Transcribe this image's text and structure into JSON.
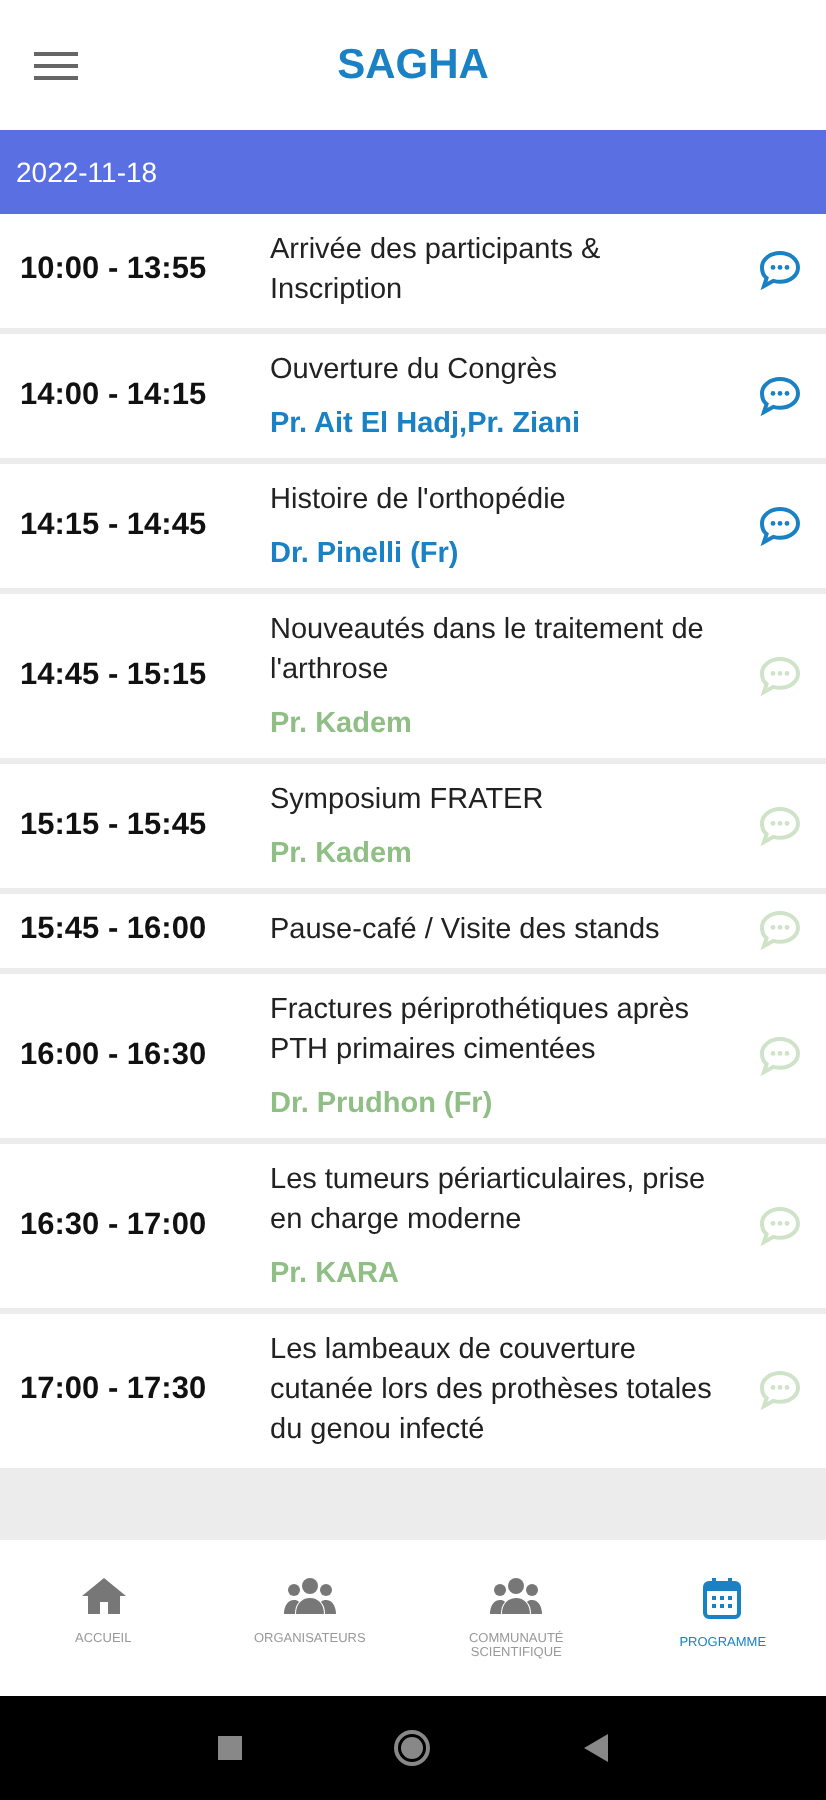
{
  "app_bar": {
    "title": "SAGHA"
  },
  "date": "2022-11-18",
  "sessions": [
    {
      "time": "10:00 - 13:55",
      "title": "Arrivée des participants & Inscription",
      "highlighted": true
    },
    {
      "time": "14:00 - 14:15",
      "title": "Ouverture du Congrès",
      "speaker": "Pr. Ait El Hadj,Pr. Ziani",
      "highlighted": true
    },
    {
      "time": "14:15 - 14:45",
      "title": "Histoire de l'orthopédie",
      "speaker": "Dr. Pinelli (Fr)",
      "highlighted": true
    },
    {
      "time": "14:45 - 15:15",
      "title": "Nouveautés dans le traitement de l'arthrose",
      "speaker": "Pr. Kadem",
      "highlighted": false
    },
    {
      "time": "15:15 - 15:45",
      "title": "Symposium FRATER",
      "speaker": "Pr. Kadem",
      "highlighted": false
    },
    {
      "time": "15:45 - 16:00",
      "title": "Pause-café / Visite des stands",
      "highlighted": false
    },
    {
      "time": "16:00 - 16:30",
      "title": "Fractures périprothétiques après PTH primaires cimentées",
      "speaker": "Dr. Prudhon (Fr)",
      "highlighted": false
    },
    {
      "time": "16:30 - 17:00",
      "title": "Les tumeurs périarticulaires, prise en charge moderne",
      "speaker": "Pr. KARA",
      "highlighted": false
    },
    {
      "time": "17:00 - 17:30",
      "title": "Les lambeaux de couverture cutanée lors des prothèses totales du genou infecté",
      "highlighted": false
    }
  ],
  "bottom_nav": [
    {
      "label": "ACCUEIL",
      "kind": "home",
      "selected": false
    },
    {
      "label": "ORGANISATEURS",
      "kind": "group",
      "selected": false
    },
    {
      "label": "COMMUNAUTÉ SCIENTIFIQUE",
      "kind": "group",
      "selected": false
    },
    {
      "label": "PROGRAMME",
      "kind": "calendar",
      "selected": true
    }
  ]
}
